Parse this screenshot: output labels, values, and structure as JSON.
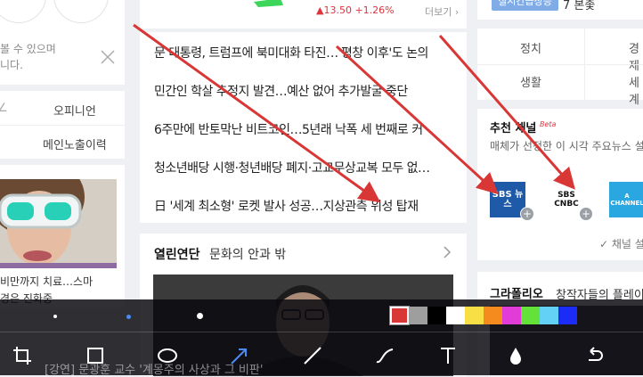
{
  "left": {
    "notice_text": "볼 수 있으며\n니다.",
    "links": [
      "오피니언",
      "메인노출이력"
    ],
    "caption": "비만까지 치료…스마\n경은 진화중"
  },
  "center": {
    "stock_change": "▲13.50 +1.26%",
    "more_label": "더보기",
    "headlines": [
      "문 대통령, 트럼프에 북미대화 타진…'평창 이후'도 논의",
      "민간인 학살 추정지 발견…예산 없어 추가발굴 중단",
      "6주만에 반토막난 비트코인…5년래 낙폭 세 번째로 커",
      "청소년배당 시행·청년배당 폐지·고교무상교복 모두 없…",
      "日 '세계 최소형' 로켓 발사 성공…지상관측 위성 탑재"
    ],
    "section_title": "열린연단",
    "section_subtitle": "문화의 안과 밖",
    "video_caption": "[강연] 문광훈 교수 '계몽주의 사상과 그 비판'"
  },
  "right": {
    "live_badge": "실시간급상승",
    "rank_item": "7 본좇",
    "categories": [
      "정치",
      "경제",
      "생활",
      "세계"
    ],
    "channel_title": "추천 채널",
    "channel_beta": "Beta",
    "channel_desc": "매체가 선정한 이 시각 주요뉴스 설정",
    "channels": [
      "SBS 뉴스",
      "SBS CNBC",
      "A CHANNEL"
    ],
    "channel_setting": "✓ 채널 설정",
    "gallery_title": "그라폴리오",
    "gallery_subtitle": "창작자들의 플레이"
  },
  "toolbar": {
    "colors": [
      "#d93636",
      "#9e9e9e",
      "#000000",
      "#ffffff",
      "#f7df45",
      "#f58a1f",
      "#e23cd8",
      "#63e33a",
      "#63d0f5",
      "#1a2cf5"
    ],
    "selected_color": "#d93636",
    "tools": [
      "crop-icon",
      "rectangle-icon",
      "ellipse-icon",
      "arrow-icon",
      "line-icon",
      "freehand-icon",
      "text-icon",
      "blur-drop-icon",
      "undo-icon"
    ],
    "active_tool": "arrow-icon"
  }
}
